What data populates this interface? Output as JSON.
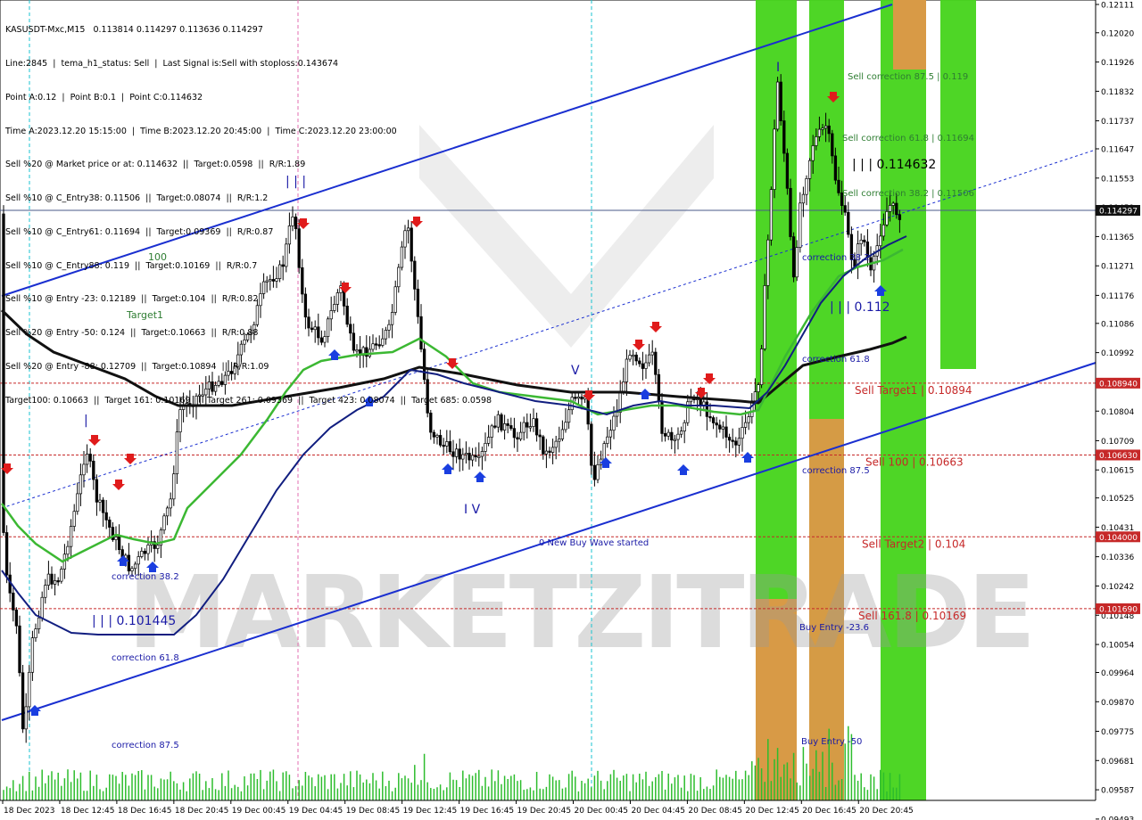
{
  "header": {
    "lines": [
      "KASUSDT-Mxc,M15   0.113814 0.114297 0.113636 0.114297",
      "Line:2845  |  tema_h1_status: Sell  |  Last Signal is:Sell with stoploss:0.143674",
      "Point A:0.12  |  Point B:0.1  |  Point C:0.114632",
      "Time A:2023.12.20 15:15:00  |  Time B:2023.12.20 20:45:00  |  Time C:2023.12.20 23:00:00",
      "Sell %20 @ Market price or at: 0.114632  ||  Target:0.0598  ||  R/R:1.89",
      "Sell %10 @ C_Entry38: 0.11506  ||  Target:0.08074  ||  R/R:1.2",
      "Sell %10 @ C_Entry61: 0.11694  ||  Target:0.09369  ||  R/R:0.87",
      "Sell %10 @ C_Entry88: 0.119  ||  Target:0.10169  ||  R/R:0.7",
      "Sell %10 @ Entry -23: 0.12189  ||  Target:0.104  ||  R/R:0.82",
      "Sell %20 @ Entry -50: 0.124  ||  Target:0.10663  ||  R/R:0.88",
      "Sell %20 @ Entry -88: 0.12709  ||  Target:0.10894  ||  R/R:1.09",
      "Target100: 0.10663  ||  Target 161: 0.10169  ||  Target 261: 0.09369  ||  Target 423: 0.08074  ||  Target 685: 0.0598"
    ]
  },
  "chart_data": {
    "type": "candlestick",
    "symbol": "KASUSDT-Mxc",
    "timeframe": "M15",
    "ohlc_last": {
      "open": 0.113814,
      "high": 0.114297,
      "low": 0.113636,
      "close": 0.114297
    },
    "current_price": "0.114297",
    "y_ticks": [
      "0.12111",
      "0.12020",
      "0.11926",
      "0.11832",
      "0.11737",
      "0.11647",
      "0.11553",
      "0.11459",
      "0.11365",
      "0.11271",
      "0.11176",
      "0.11086",
      "0.10992",
      "0.10898",
      "0.10804",
      "0.10709",
      "0.10615",
      "0.10525",
      "0.10431",
      "0.10336",
      "0.10242",
      "0.10148",
      "0.10054",
      "0.09964",
      "0.09870",
      "0.09775",
      "0.09681",
      "0.09587",
      "0.09493",
      "0.09403"
    ],
    "y_tick_values": [
      0.12111,
      0.1202,
      0.11926,
      0.11832,
      0.11737,
      0.11647,
      0.11553,
      0.11459,
      0.11365,
      0.11271,
      0.11176,
      0.11086,
      0.10992,
      0.10898,
      0.10804,
      0.10709,
      0.10615,
      0.10525,
      0.10431,
      0.10336,
      0.10242,
      0.10148,
      0.10054,
      0.09964,
      0.0987,
      0.09775,
      0.09681,
      0.09587,
      0.09493,
      0.09403
    ],
    "x_ticks": [
      "18 Dec 2023",
      "18 Dec 12:45",
      "18 Dec 16:45",
      "18 Dec 20:45",
      "19 Dec 00:45",
      "19 Dec 04:45",
      "19 Dec 08:45",
      "19 Dec 12:45",
      "19 Dec 16:45",
      "19 Dec 20:45",
      "20 Dec 00:45",
      "20 Dec 04:45",
      "20 Dec 08:45",
      "20 Dec 12:45",
      "20 Dec 16:45",
      "20 Dec 20:45"
    ],
    "price_labels": [
      {
        "label": "0.108940",
        "value": 0.10894,
        "color": "#c62828"
      },
      {
        "label": "0.106630",
        "value": 0.10663,
        "color": "#c62828"
      },
      {
        "label": "0.104000",
        "value": 0.104,
        "color": "#c62828"
      },
      {
        "label": "0.101690",
        "value": 0.10169,
        "color": "#c62828"
      }
    ],
    "levels": [
      {
        "text": "Sell Target1 | 0.10894",
        "value": 0.10894
      },
      {
        "text": "Sell 100 | 0.10663",
        "value": 0.10663
      },
      {
        "text": "Sell Target2 | 0.104",
        "value": 0.104
      },
      {
        "text": "Sell 161.8 | 0.10169",
        "value": 0.10169
      }
    ],
    "annotations": [
      {
        "text": "Sell correction 87.5 | 0.119",
        "value": 0.119,
        "color": "#2e7d32"
      },
      {
        "text": "Sell correction 61.8 | 0.11694",
        "value": 0.11694,
        "color": "#2e7d32"
      },
      {
        "text": "| | | 0.114632",
        "value": 0.114632,
        "color": "#000000"
      },
      {
        "text": "Sell correction 38.2 | 0.11506",
        "value": 0.11506,
        "color": "#2e7d32"
      },
      {
        "text": "correction 38.2",
        "value": 0.1125,
        "color": "#1a1aa6"
      },
      {
        "text": "| | | 0.112",
        "value": 0.1112,
        "color": "#1a1aa6"
      },
      {
        "text": "correction 61.8",
        "value": 0.1097,
        "color": "#1a1aa6"
      },
      {
        "text": "correction 87.5",
        "value": 0.1054,
        "color": "#1a1aa6"
      },
      {
        "text": "Buy Entry -23.6",
        "value": 0.1009,
        "color": "#1a1aa6"
      },
      {
        "text": "Buy Entry -50",
        "value": 0.0964,
        "color": "#1a1aa6"
      },
      {
        "text": "100",
        "value": 0.1125,
        "color": "#2e7d32"
      },
      {
        "text": "Target1",
        "value": 0.1109,
        "color": "#2e7d32"
      },
      {
        "text": "| | |",
        "value": 0.1153,
        "color": "#1a1aa6"
      },
      {
        "text": "|",
        "value": 0.1072,
        "color": "#1a1aa6"
      },
      {
        "text": "correction 38.2",
        "value": 0.1024,
        "color": "#1a1aa6"
      },
      {
        "text": "| | | 0.101445",
        "value": 0.1011,
        "color": "#1a1aa6"
      },
      {
        "text": "correction 61.8",
        "value": 0.0993,
        "color": "#1a1aa6"
      },
      {
        "text": "correction 87.5",
        "value": 0.0963,
        "color": "#1a1aa6"
      },
      {
        "text": "V",
        "value": 0.1092,
        "color": "#1a1aa6"
      },
      {
        "text": "I V",
        "value": 0.1051,
        "color": "#1a1aa6"
      },
      {
        "text": "0 New Buy Wave started",
        "value": 0.1035,
        "color": "#1a1aa6"
      },
      {
        "text": "I",
        "value": 0.1194,
        "color": "#1a1aa6"
      }
    ],
    "watermark": "MARKETZITRADE"
  }
}
